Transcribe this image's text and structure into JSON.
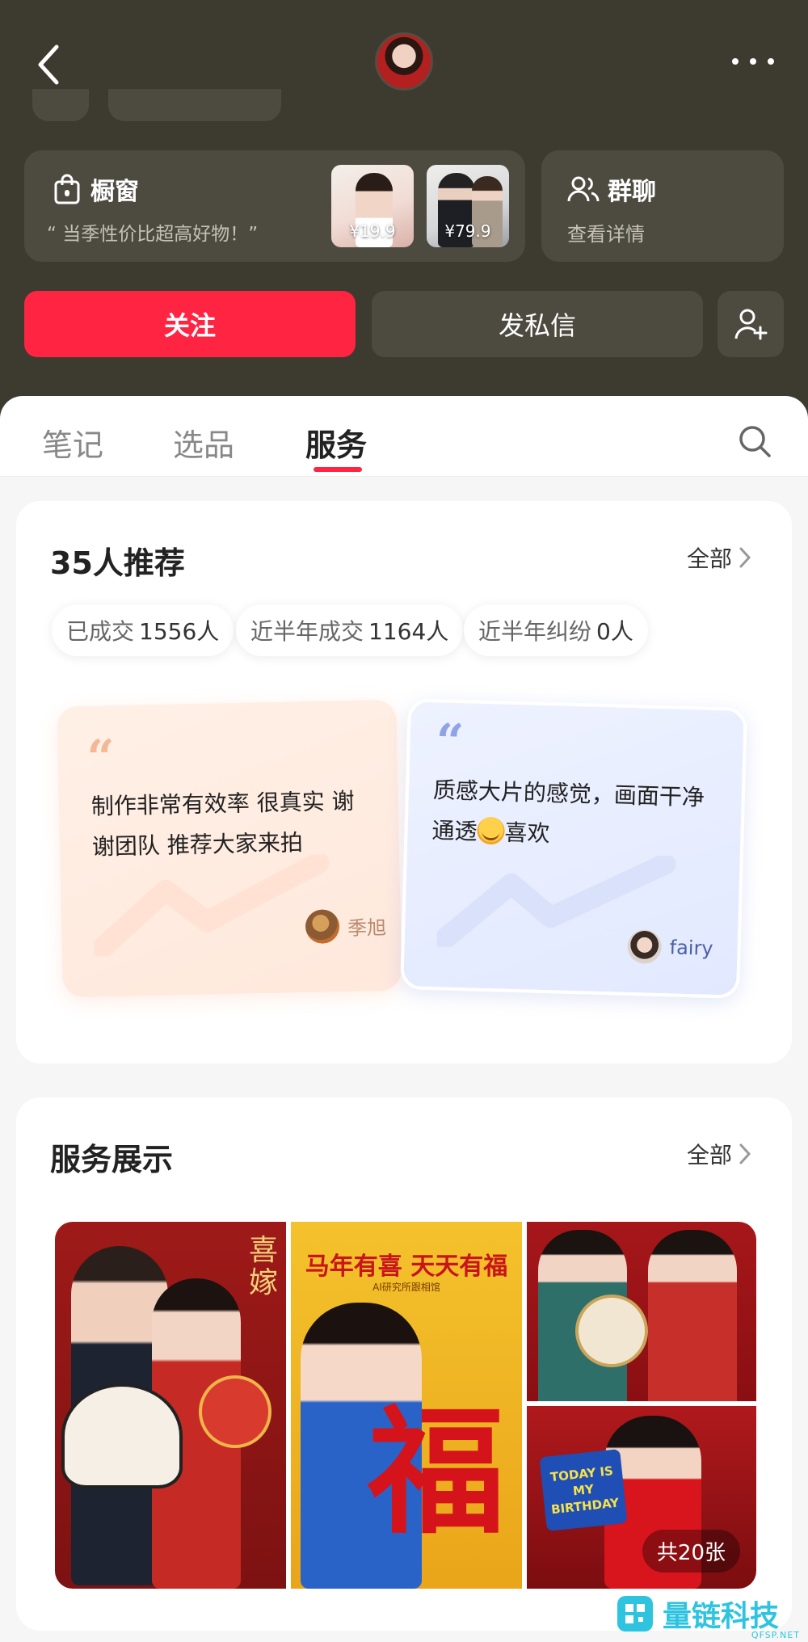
{
  "header": {
    "shop": {
      "title": "橱窗",
      "quote": "“ 当季性价比超高好物！”",
      "items": [
        {
          "price": "¥19.9"
        },
        {
          "price": "¥79.9"
        }
      ]
    },
    "group": {
      "title": "群聊",
      "subtitle": "查看详情"
    },
    "follow_label": "关注",
    "message_label": "发私信"
  },
  "tabs": [
    {
      "label": "笔记",
      "active": false
    },
    {
      "label": "选品",
      "active": false
    },
    {
      "label": "服务",
      "active": true
    }
  ],
  "recommend": {
    "title": "35人推荐",
    "see_all": "全部",
    "stats": [
      {
        "label": "已成交",
        "value": "1556人"
      },
      {
        "label": "近半年成交",
        "value": "1164人"
      },
      {
        "label": "近半年纠纷",
        "value": "0人"
      }
    ],
    "reviews": [
      {
        "quote_mark": "“",
        "text": "制作非常有效率 很真实 谢谢团队 推荐大家来拍",
        "author": "季旭"
      },
      {
        "quote_mark": "“",
        "text_before": "质感大片的感觉，画面干净通透",
        "text_after": "喜欢",
        "author": "fairy"
      }
    ]
  },
  "services": {
    "title": "服务展示",
    "see_all": "全部",
    "photo1_text": "喜嫁",
    "photo2_headline": "马年有喜 天天有福",
    "photo2_subline": "AI研究所跟相馆",
    "photo2_char": "福",
    "photo4_sign": "TODAY IS MY BIRTHDAY",
    "count_label": "共20张"
  },
  "watermark": {
    "text": "量链科技",
    "sub": "QFSP.NET"
  },
  "colors": {
    "accent": "#ff2442",
    "header_bg": "#3d3a30"
  }
}
